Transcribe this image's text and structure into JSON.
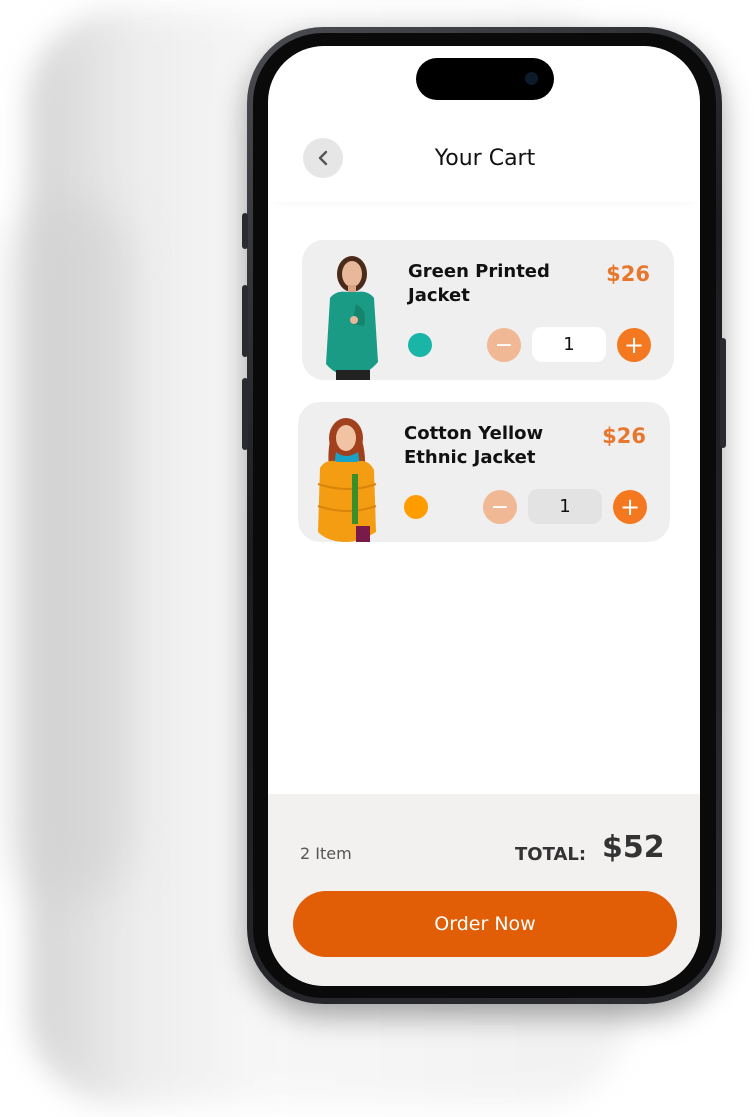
{
  "screen": {
    "title": "Your Cart"
  },
  "header": {
    "back_icon": "chevron-left-icon"
  },
  "cart": {
    "items": [
      {
        "name": "Green Printed Jacket",
        "price": "$26",
        "color": "#19b5a6",
        "quantity": "1",
        "image": "woman-green-jacket"
      },
      {
        "name": "Cotton Yellow Ethnic Jacket",
        "price": "$26",
        "color": "#ff9c00",
        "quantity": "1",
        "image": "woman-yellow-jacket"
      }
    ]
  },
  "summary": {
    "item_count": "2 Item",
    "total_label": "TOTAL:",
    "total_value": "$52",
    "order_button": "Order Now"
  },
  "colors": {
    "accent": "#e15e07",
    "plus": "#f4781f",
    "minus": "#f0b894",
    "price": "#e8772e"
  }
}
